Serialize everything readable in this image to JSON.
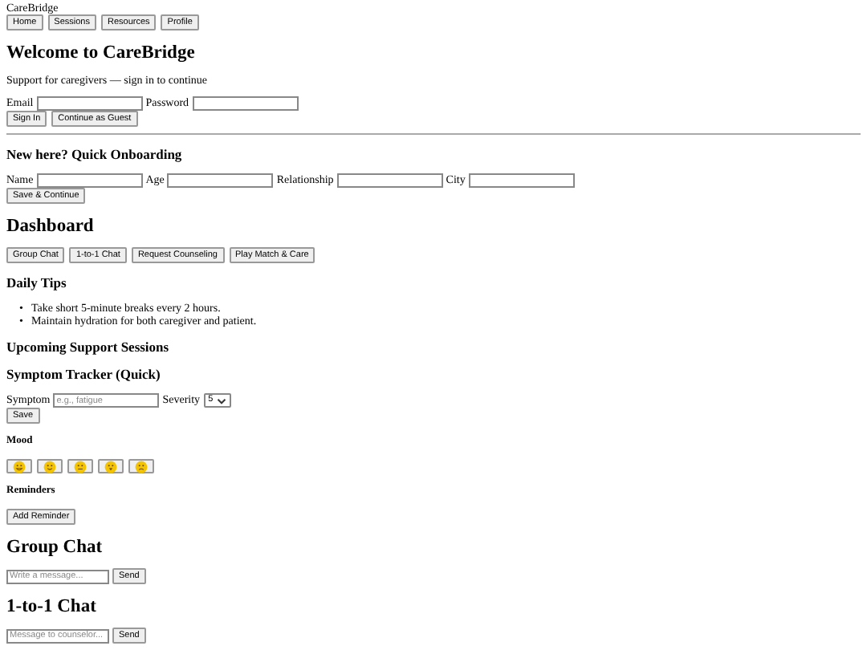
{
  "brand": "CareBridge",
  "nav": [
    {
      "label": "Home"
    },
    {
      "label": "Sessions"
    },
    {
      "label": "Resources"
    },
    {
      "label": "Profile"
    }
  ],
  "welcome": {
    "title": "Welcome to CareBridge",
    "subtitle": "Support for caregivers — sign in to continue",
    "fields": [
      {
        "label": "Email"
      },
      {
        "label": "Password"
      }
    ],
    "buttons": [
      "Sign In",
      "Continue as Guest"
    ]
  },
  "onboarding": {
    "title": "New here? Quick Onboarding",
    "fields": [
      {
        "label": "Name"
      },
      {
        "label": "Age"
      },
      {
        "label": "Relationship"
      },
      {
        "label": "City"
      }
    ],
    "button": "Save & Continue"
  },
  "dashboard": {
    "title": "Dashboard",
    "buttons": [
      "Group Chat",
      "1-to-1 Chat",
      "Request Counseling",
      "Play Match & Care"
    ],
    "tips_title": "Daily Tips",
    "tips": [
      {
        "marker": "•",
        "text": "Take short 5-minute breaks every 2 hours."
      },
      {
        "marker": "•",
        "text": "Maintain hydration for both caregiver and patient."
      }
    ],
    "sessions_title": "Upcoming Support Sessions",
    "tracker": {
      "title": "Symptom Tracker (Quick)",
      "symptom_label": "Symptom",
      "placeholder": "e.g., fatigue",
      "severity_label": "Severity",
      "severity": "5",
      "button": "Save"
    },
    "mood": {
      "title": "Mood",
      "options": [
        {
          "kind": "grin"
        },
        {
          "kind": "smile"
        },
        {
          "kind": "neutral"
        },
        {
          "kind": "surprised"
        },
        {
          "kind": "sad"
        }
      ]
    },
    "reminders": {
      "title": "Reminders",
      "button": "Add Reminder"
    }
  },
  "group_chat": {
    "title": "Group Chat",
    "placeholder": "Write a message...",
    "button": "Send"
  },
  "private_chat": {
    "title": "1-to-1 Chat",
    "placeholder": "Message to counselor...",
    "button": "Send"
  }
}
